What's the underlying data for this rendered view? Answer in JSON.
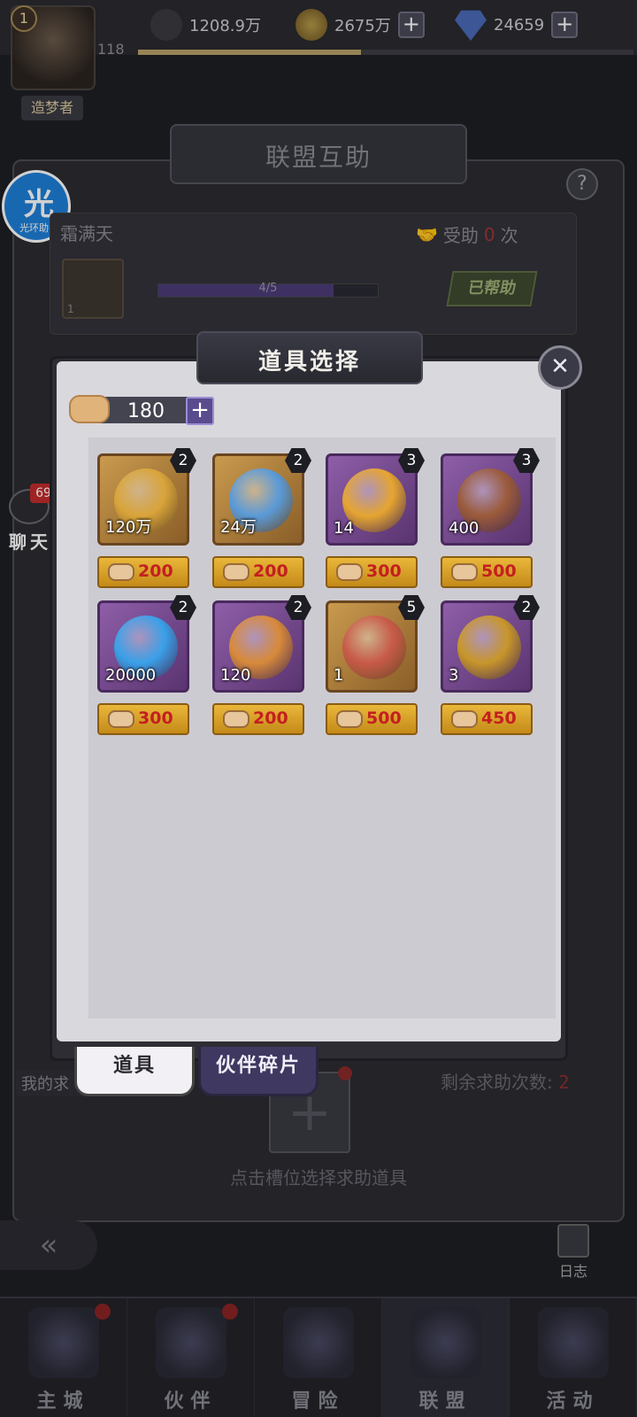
{
  "player": {
    "level": "1",
    "number": "118",
    "title": "造梦者"
  },
  "resources": {
    "power": "1208.9万",
    "gold": "2675万",
    "diamonds": "24659",
    "xp_fill": 0.45
  },
  "assistant": {
    "char": "光",
    "label": "光环助手"
  },
  "panel": {
    "title": "联盟互助",
    "help": "?"
  },
  "request": {
    "name": "霜满天",
    "helped_prefix": "受助",
    "helped_count": "0",
    "helped_suffix": "次",
    "item_qty": "1",
    "progress_text": "4/5",
    "progress_value": 0.8,
    "helped_button": "已帮助"
  },
  "chat": {
    "badge": "69",
    "label": "聊天"
  },
  "modal": {
    "title": "道具选择",
    "close": "✕",
    "token_value": "180",
    "token_plus": "+",
    "items": [
      {
        "name": "gold-coin",
        "qty": "120万",
        "count": "2",
        "cost": "200",
        "rarity": "gold",
        "color": "#d9a43a"
      },
      {
        "name": "exp-star",
        "qty": "24万",
        "count": "2",
        "cost": "200",
        "rarity": "gold",
        "color": "#5a9ad8"
      },
      {
        "name": "amber-gem",
        "qty": "14",
        "count": "3",
        "cost": "300",
        "rarity": "purple",
        "color": "#e6a530"
      },
      {
        "name": "spiral-orb",
        "qty": "400",
        "count": "3",
        "cost": "500",
        "rarity": "purple",
        "color": "#9a5a3a"
      },
      {
        "name": "blue-crystal",
        "qty": "20000",
        "count": "2",
        "cost": "300",
        "rarity": "purple",
        "color": "#3aa0e8"
      },
      {
        "name": "fire-ore",
        "qty": "120",
        "count": "2",
        "cost": "200",
        "rarity": "purple",
        "color": "#d88a3a"
      },
      {
        "name": "flame-crystal",
        "qty": "1",
        "count": "5",
        "cost": "500",
        "rarity": "gold",
        "color": "#c85a48"
      },
      {
        "name": "gold-medallion",
        "qty": "3",
        "count": "2",
        "cost": "450",
        "rarity": "purple",
        "color": "#c8962a"
      }
    ]
  },
  "tabs": {
    "items": "道具",
    "fragments": "伙伴碎片"
  },
  "my_request": {
    "label": "我的求",
    "remaining_prefix": "剩余求助次数:",
    "remaining_count": "2",
    "add": "+",
    "hint": "点击槽位选择求助道具"
  },
  "log": {
    "label": "日志"
  },
  "back": {
    "icon": "«"
  },
  "nav": [
    {
      "label": "主城",
      "dot": true
    },
    {
      "label": "伙伴",
      "dot": true
    },
    {
      "label": "冒险",
      "dot": false
    },
    {
      "label": "联盟",
      "dot": false
    },
    {
      "label": "活动",
      "dot": false
    }
  ]
}
